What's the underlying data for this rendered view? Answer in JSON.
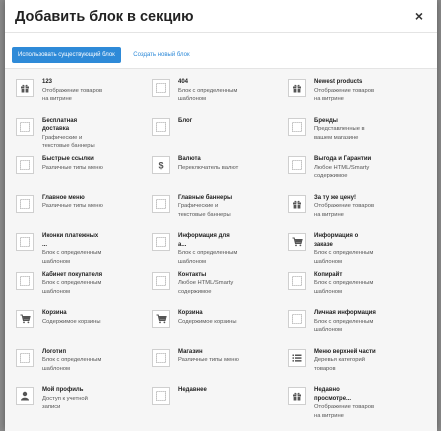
{
  "dialog": {
    "title": "Добавить блок в секцию",
    "close_glyph": "×"
  },
  "tabs": [
    {
      "label": "Использовать существующий блок",
      "active": true
    },
    {
      "label": "Создать новый блок",
      "active": false
    }
  ],
  "colors": {
    "accent": "#2e8ad8",
    "icon": "#555555",
    "placeholder_icon": "#9a9a9a"
  },
  "blocks": [
    {
      "name": "123",
      "desc": [
        "Отображение товаров",
        "на витрине"
      ],
      "icon": "gift-icon"
    },
    {
      "name": "404",
      "desc": [
        "Блок с определенным",
        "шаблоном"
      ],
      "icon": "placeholder-icon"
    },
    {
      "name": "Newest products",
      "desc": [
        "Отображение товаров",
        "на витрине"
      ],
      "icon": "gift-icon"
    },
    {
      "name": "Бесплатная",
      "name2": "доставка",
      "desc": [
        "Графические и",
        "текстовые баннеры"
      ],
      "icon": "placeholder-icon"
    },
    {
      "name": "Блог",
      "desc": [],
      "icon": "placeholder-icon"
    },
    {
      "name": "Бренды",
      "desc": [
        "Представленные в",
        "вашем магазине"
      ],
      "icon": "placeholder-icon"
    },
    {
      "name": "Быстрые ссылки",
      "desc": [
        "Различные типы меню"
      ],
      "icon": "placeholder-icon"
    },
    {
      "name": "Валюта",
      "desc": [
        "Переключатель валют"
      ],
      "icon": "dollar-icon"
    },
    {
      "name": "Выгода и Гарантии",
      "desc": [
        "Любое HTML/Smarty",
        "содержимое"
      ],
      "icon": "placeholder-icon"
    },
    {
      "name": "Главное меню",
      "desc": [
        "Различные типы меню"
      ],
      "icon": "placeholder-icon"
    },
    {
      "name": "Главные баннеры",
      "desc": [
        "Графические и",
        "текстовые баннеры"
      ],
      "icon": "placeholder-icon"
    },
    {
      "name": "За ту же цену!",
      "desc": [
        "Отображение товаров",
        "на витрине"
      ],
      "icon": "gift-icon"
    },
    {
      "name": "Иконки платежных",
      "name2": "...",
      "desc": [
        "Блок с определенным",
        "шаблоном"
      ],
      "icon": "placeholder-icon"
    },
    {
      "name": "Информация для",
      "name2": "а...",
      "desc": [
        "Блок с определенным",
        "шаблоном"
      ],
      "icon": "placeholder-icon"
    },
    {
      "name": "Информация о",
      "name2": "заказе",
      "desc": [
        "Блок с определенным",
        "шаблоном"
      ],
      "icon": "cart-icon"
    },
    {
      "name": "Кабинет покупателя",
      "desc": [
        "Блок с определенным",
        "шаблоном"
      ],
      "icon": "placeholder-icon"
    },
    {
      "name": "Контакты",
      "desc": [
        "Любое HTML/Smarty",
        "содержимое"
      ],
      "icon": "placeholder-icon"
    },
    {
      "name": "Копирайт",
      "desc": [
        "Блок с определенным",
        "шаблоном"
      ],
      "icon": "placeholder-icon"
    },
    {
      "name": "Корзина",
      "desc": [
        "Содержимое корзины"
      ],
      "icon": "cart-icon"
    },
    {
      "name": "Корзина",
      "desc": [
        "Содержимое корзины"
      ],
      "icon": "cart-icon"
    },
    {
      "name": "Личная информация",
      "desc": [
        "Блок с определенным",
        "шаблоном"
      ],
      "icon": "placeholder-icon"
    },
    {
      "name": "Логотип",
      "desc": [
        "Блок с определенным",
        "шаблоном"
      ],
      "icon": "placeholder-icon"
    },
    {
      "name": "Магазин",
      "desc": [
        "Различные типы меню"
      ],
      "icon": "placeholder-icon"
    },
    {
      "name": "Меню верхней части",
      "desc": [
        "Деревья категорий",
        "товаров"
      ],
      "icon": "list-icon"
    },
    {
      "name": "Мой профиль",
      "desc": [
        "Доступ к учетной",
        "записи"
      ],
      "icon": "user-icon"
    },
    {
      "name": "Недавнее",
      "desc": [],
      "icon": "placeholder-icon"
    },
    {
      "name": "Недавно",
      "name2": "просмотре...",
      "desc": [
        "Отображение товаров",
        "на витрине"
      ],
      "icon": "gift-icon"
    }
  ]
}
